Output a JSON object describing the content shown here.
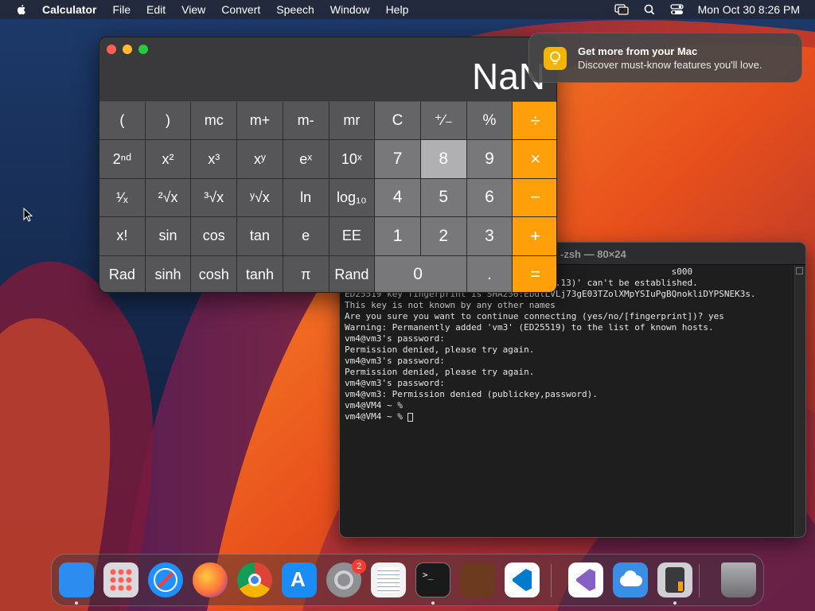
{
  "menubar": {
    "app_name": "Calculator",
    "menus": [
      "File",
      "Edit",
      "View",
      "Convert",
      "Speech",
      "Window",
      "Help"
    ],
    "clock": "Mon Oct 30  8:26 PM",
    "icons": [
      "apple-icon",
      "screen-mirroring-icon",
      "search-icon",
      "control-center-icon"
    ]
  },
  "calculator": {
    "display": "NaN",
    "rows": [
      [
        "(",
        ")",
        "mc",
        "m+",
        "m-",
        "mr",
        "C",
        "⁺∕₋",
        "%",
        "÷"
      ],
      [
        "2ⁿᵈ",
        "x²",
        "x³",
        "xʸ",
        "eˣ",
        "10ˣ",
        "7",
        "8",
        "9",
        "×"
      ],
      [
        "¹∕ₓ",
        "²√x",
        "³√x",
        "ʸ√x",
        "ln",
        "log₁₀",
        "4",
        "5",
        "6",
        "−"
      ],
      [
        "x!",
        "sin",
        "cos",
        "tan",
        "e",
        "EE",
        "1",
        "2",
        "3",
        "+"
      ],
      [
        "Rad",
        "sinh",
        "cosh",
        "tanh",
        "π",
        "Rand",
        "0",
        ".",
        "="
      ]
    ]
  },
  "notification": {
    "title": "Get more from your Mac",
    "body": "Discover must-know features you'll love."
  },
  "terminal": {
    "title": "-zsh — 80×24",
    "lines": [
      "                                                              s000",
      "The authenticity of host 'vm3 (192.168.1.13)' can't be established.",
      "ED25519 key fingerprint is SHA256:EbdtLVLj73gE03TZolXMpYSIuPgBQnokliDYPSNEK3s.",
      "This key is not known by any other names",
      "Are you sure you want to continue connecting (yes/no/[fingerprint])? yes",
      "Warning: Permanently added 'vm3' (ED25519) to the list of known hosts.",
      "vm4@vm3's password:",
      "Permission denied, please try again.",
      "vm4@vm3's password:",
      "Permission denied, please try again.",
      "vm4@vm3's password:",
      "vm4@vm3: Permission denied (publickey,password).",
      "vm4@VM4 ~ %",
      "vm4@VM4 ~ % "
    ]
  },
  "dock": {
    "items": [
      {
        "name": "Finder",
        "icon": "finder-icon",
        "color": "#2d8cf0",
        "running": true
      },
      {
        "name": "Launchpad",
        "icon": "launchpad-icon",
        "color": "#d9d9de",
        "running": false
      },
      {
        "name": "Safari",
        "icon": "safari-icon",
        "color": "#1e90ff",
        "running": false
      },
      {
        "name": "Firefox",
        "icon": "firefox-icon",
        "color": "#ff7139",
        "running": false
      },
      {
        "name": "Chrome",
        "icon": "chrome-icon",
        "color": "#ffffff",
        "running": false
      },
      {
        "name": "App Store",
        "icon": "app-store-icon",
        "color": "#1c8cf5",
        "running": false
      },
      {
        "name": "System Settings",
        "icon": "system-settings-icon",
        "color": "#8e8e93",
        "running": false,
        "badge": "2"
      },
      {
        "name": "TextEdit",
        "icon": "textedit-icon",
        "color": "#f2f2f2",
        "running": false
      },
      {
        "name": "Terminal",
        "icon": "terminal-icon",
        "color": "#1a1a1a",
        "running": true
      },
      {
        "name": "GarageBand",
        "icon": "garageband-icon",
        "color": "#6b3a1f",
        "running": false
      },
      {
        "name": "Visual Studio Code",
        "icon": "vscode-icon",
        "color": "#ffffff",
        "running": false
      },
      {
        "name": "Visual Studio",
        "icon": "visual-studio-icon",
        "color": "#ffffff",
        "running": false
      },
      {
        "name": "Weather",
        "icon": "weather-icon",
        "color": "#3a8ee6",
        "running": false
      },
      {
        "name": "Calculator",
        "icon": "calculator-icon",
        "color": "#d0d0d4",
        "running": true
      },
      {
        "name": "Trash",
        "icon": "trash-icon",
        "color": "#8a8a8e",
        "running": false
      }
    ]
  },
  "colors": {
    "operator": "#ff9f0a",
    "accent_orange": "#f26b1d"
  }
}
